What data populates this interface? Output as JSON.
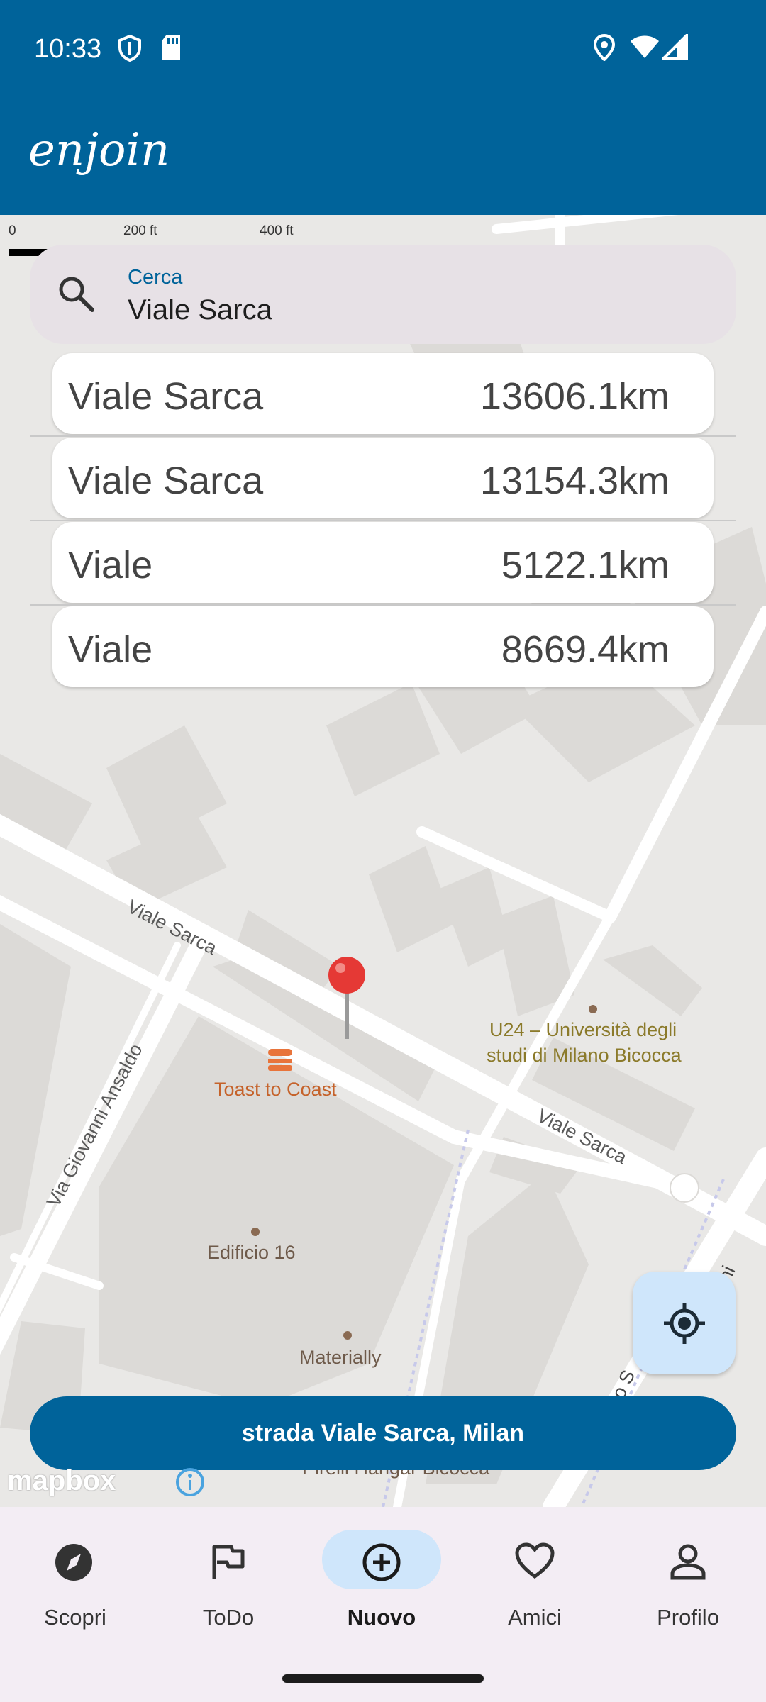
{
  "status": {
    "time": "10:33"
  },
  "app": {
    "title": "enjoin"
  },
  "map": {
    "scale": {
      "s0": "0",
      "s1": "200 ft",
      "s2": "400 ft"
    },
    "labels": {
      "street1": "Viale Sarca",
      "street2": "Viale Sarca",
      "street3": "Via Giovanni Ansaldo",
      "street4": "sto S",
      "street5": "nni",
      "poi1": "U24 – Università degli",
      "poi1b": "studi di Milano Bicocca",
      "poi2": "Toast to Coast",
      "poi3": "Edificio 16",
      "poi4": "Materially",
      "poi5": "Pirelli Hangar Bicocca"
    },
    "attribution": "mapbox"
  },
  "search": {
    "label": "Cerca",
    "value": "Viale Sarca"
  },
  "results": [
    {
      "name": "Viale Sarca",
      "distance": "13606.1km"
    },
    {
      "name": "Viale Sarca",
      "distance": "13154.3km"
    },
    {
      "name": "Viale",
      "distance": "5122.1km"
    },
    {
      "name": "Viale",
      "distance": "8669.4km"
    }
  ],
  "address_button": "strada Viale Sarca, Milan",
  "nav": [
    {
      "label": "Scopri",
      "icon": "compass-icon"
    },
    {
      "label": "ToDo",
      "icon": "flag-icon"
    },
    {
      "label": "Nuovo",
      "icon": "add-circle-icon",
      "active": true
    },
    {
      "label": "Amici",
      "icon": "heart-icon"
    },
    {
      "label": "Profilo",
      "icon": "person-icon"
    }
  ],
  "colors": {
    "primary": "#00639a",
    "accent_light": "#cfe6fb",
    "pin": "#e53935"
  }
}
